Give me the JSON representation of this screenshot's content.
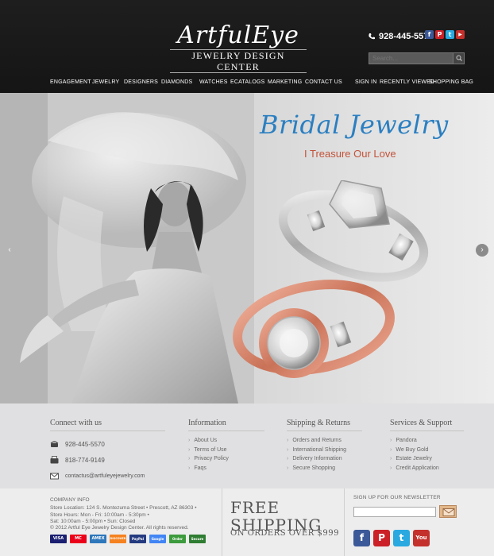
{
  "header": {
    "logo_main": "ArtfulEye",
    "logo_sub": "JEWELRY DESIGN CENTER",
    "phone": "928-445-5570",
    "search_placeholder": "Search...",
    "social": [
      {
        "icon": "facebook-icon",
        "glyph": "f",
        "color": "#3b5998"
      },
      {
        "icon": "pinterest-icon",
        "glyph": "P",
        "color": "#cb2027"
      },
      {
        "icon": "twitter-icon",
        "glyph": "t",
        "color": "#29a9e0"
      },
      {
        "icon": "youtube-icon",
        "glyph": "▶",
        "color": "#c4302b"
      }
    ]
  },
  "nav": {
    "main": [
      "ENGAGEMENT",
      "JEWELRY",
      "DESIGNERS",
      "DIAMONDS",
      "WATCHES",
      "ECATALOGS",
      "MARKETING",
      "CONTACT US"
    ],
    "account": [
      "SIGN IN",
      "RECENTLY VIEWED",
      "SHOPPING BAG"
    ]
  },
  "hero": {
    "title": "Bridal Jewelry",
    "subtitle": "I Treasure Our Love",
    "title_color": "#2b7fc1",
    "subtitle_color": "#c2533a"
  },
  "footer": {
    "connect": {
      "title": "Connect with us",
      "phone": "928-445-5570",
      "fax": "818-774-9149",
      "email": "contactus@artfuleyejewelry.com"
    },
    "information": {
      "title": "Information",
      "items": [
        "About Us",
        "Terms of Use",
        "Privacy Policy",
        "Faqs"
      ]
    },
    "shipping": {
      "title": "Shipping & Returns",
      "items": [
        "Orders and Returns",
        "International Shipping",
        "Delivery Information",
        "Secure Shopping"
      ]
    },
    "services": {
      "title": "Services & Support",
      "items": [
        "Pandora",
        "We Buy Gold",
        "Estate Jewelry",
        "Credit Application"
      ]
    }
  },
  "bottom": {
    "company_title": "COMPANY INFO",
    "company_lines": [
      "Store Location: 124 S. Montezuma Street • Prescott, AZ 86303 •",
      "Store Hours: Mon - Fri: 10:00am - 5:30pm •",
      "Sat: 10:00am - 5:00pm • Sun: Closed",
      "© 2012 Artful Eye Jewelry Design Center. All rights reserved."
    ],
    "cards": [
      {
        "label": "VISA",
        "color": "#1a1f71"
      },
      {
        "label": "MC",
        "color": "#eb001b"
      },
      {
        "label": "AMEX",
        "color": "#2e77bb"
      },
      {
        "label": "DISCOVER",
        "color": "#f58220"
      },
      {
        "label": "PayPal",
        "color": "#253b80"
      },
      {
        "label": "Google",
        "color": "#4285f4"
      },
      {
        "label": "Order",
        "color": "#3c9b3c"
      },
      {
        "label": "Secure",
        "color": "#2f7d32"
      }
    ],
    "shipping_line1": "FREE",
    "shipping_line2": "SHIPPING",
    "shipping_line3": "ON ORDERS OVER $999",
    "newsletter_label": "SIGN UP FOR OUR NEWSLETTER",
    "social": [
      {
        "icon": "facebook-icon",
        "glyph": "f",
        "color": "#3b5998"
      },
      {
        "icon": "pinterest-icon",
        "glyph": "P",
        "color": "#cb2027"
      },
      {
        "icon": "twitter-icon",
        "glyph": "t",
        "color": "#29a9e0"
      },
      {
        "icon": "youtube-icon",
        "glyph": "You",
        "color": "#c4302b"
      }
    ]
  }
}
